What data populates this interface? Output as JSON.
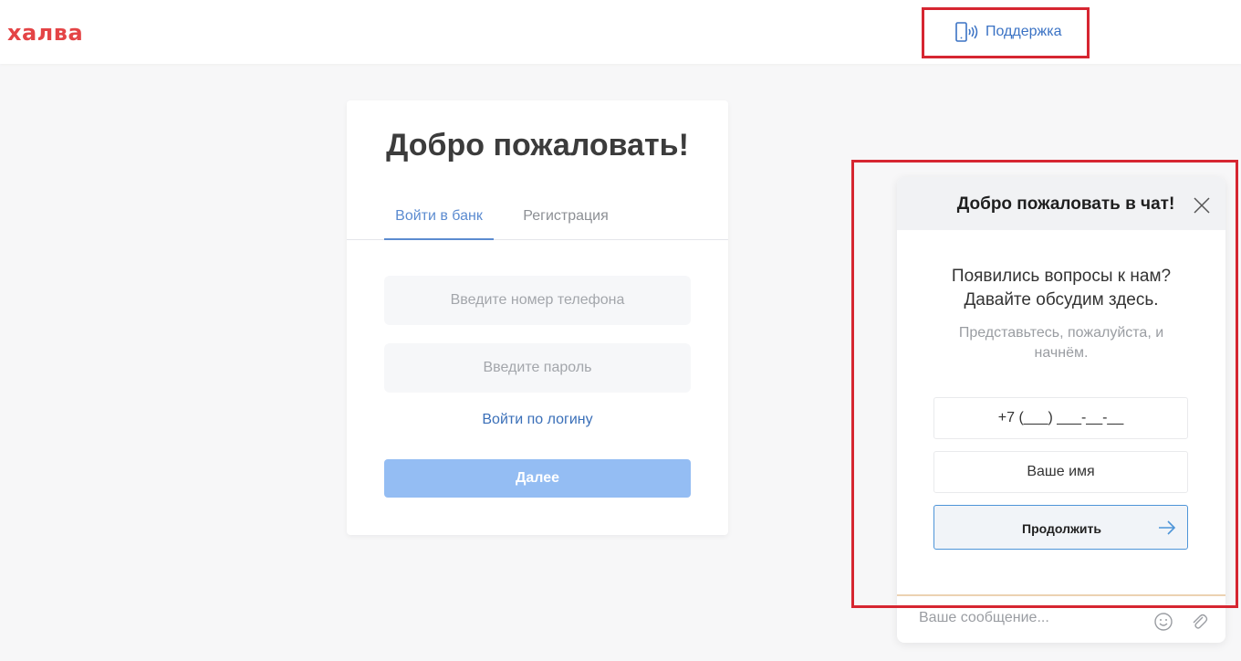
{
  "header": {
    "logo_text": "халва",
    "support_label": "Поддержка",
    "support_icon": "phone-signal-icon"
  },
  "login_card": {
    "title": "Добро пожаловать!",
    "tabs": [
      {
        "label": "Войти в банк",
        "active": true
      },
      {
        "label": "Регистрация",
        "active": false
      }
    ],
    "phone_placeholder": "Введите номер телефона",
    "password_placeholder": "Введите пароль",
    "login_link": "Войти по логину",
    "next_button": "Далее"
  },
  "chat": {
    "title": "Добро пожаловать в чат!",
    "question": "Появились вопросы к нам?\nДавайте обсудим здесь.",
    "subtitle": "Представьтесь, пожалуйста, и начнём.",
    "phone_placeholder": "+7 (___) ___-__-__",
    "name_placeholder": "Ваше имя",
    "continue_button": "Продолжить",
    "message_placeholder": "Ваше сообщение...",
    "icons": [
      "close-icon",
      "arrow-right-icon",
      "emoji-icon",
      "paperclip-icon"
    ]
  },
  "colors": {
    "brand": "#e44446",
    "link": "#3a72c4",
    "button_disabled": "#94bdf3",
    "highlight": "#d62631"
  }
}
